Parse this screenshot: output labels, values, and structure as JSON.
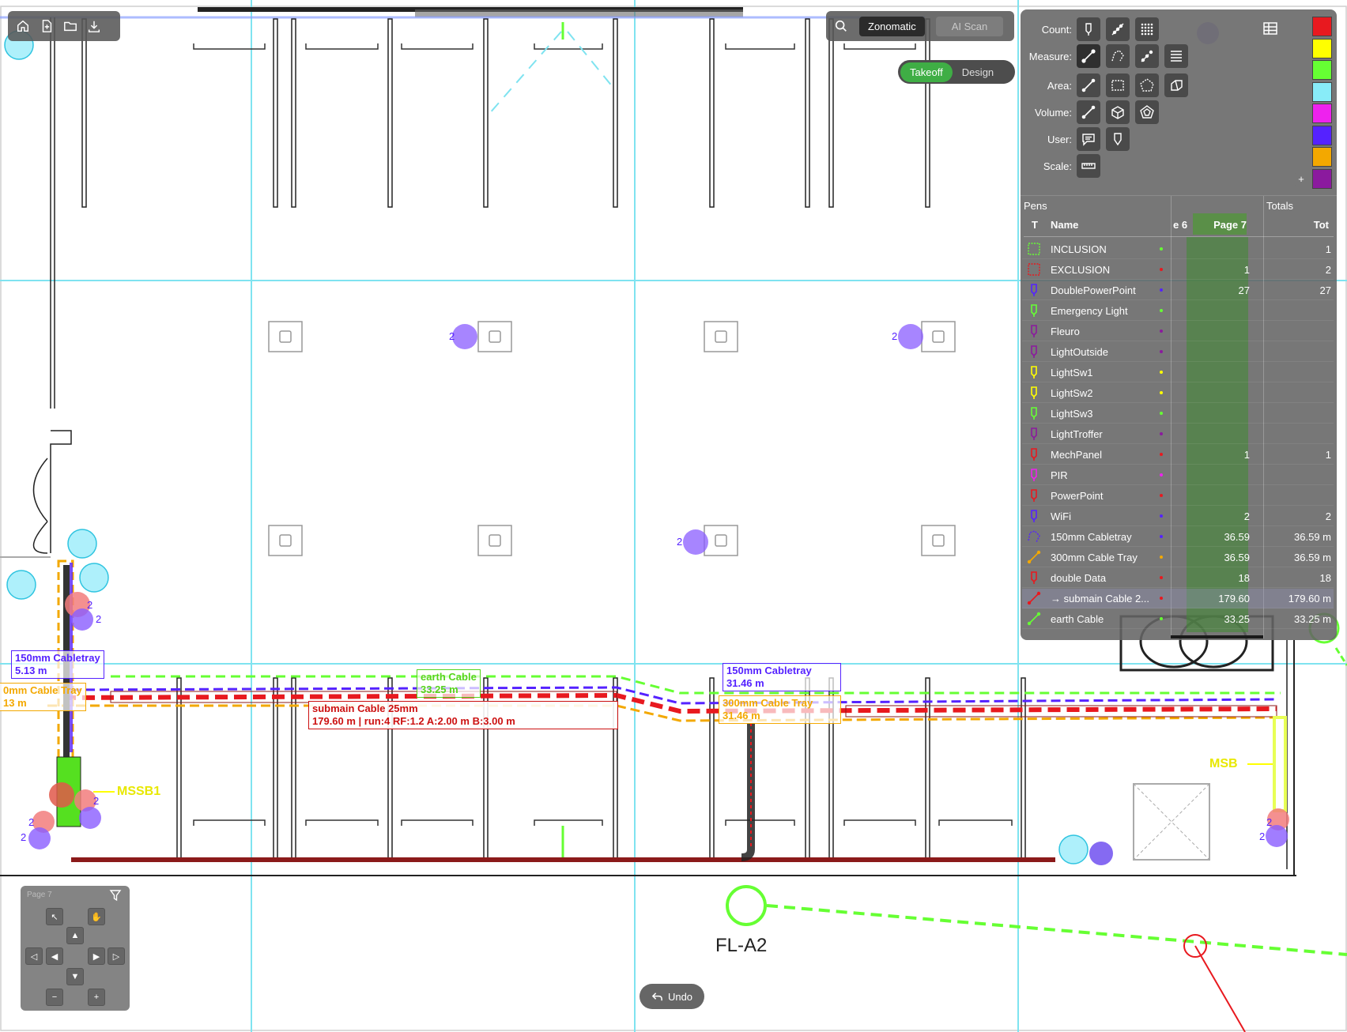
{
  "toolbar": {
    "zonomatic": "Zonomatic",
    "ai_scan": "AI Scan"
  },
  "mode": {
    "takeoff": "Takeoff",
    "design": "Design"
  },
  "tools": {
    "count": "Count:",
    "measure": "Measure:",
    "area": "Area:",
    "volume": "Volume:",
    "user": "User:",
    "scale": "Scale:"
  },
  "colors": [
    "#e8191f",
    "#ffff00",
    "#66ff33",
    "#88ecf8",
    "#ee22ee",
    "#5522ff",
    "#f3a800",
    "#8b1a9e"
  ],
  "pens": {
    "title": "Pens",
    "totals": "Totals",
    "col_t": "T",
    "col_name": "Name",
    "col_prev": "e 6",
    "col_page": "Page 7",
    "col_total": "Tot",
    "rows": [
      {
        "name": "INCLUSION",
        "page": "",
        "total": "1",
        "color": "#66ff33",
        "kind": "area"
      },
      {
        "name": "EXCLUSION",
        "page": "1",
        "total": "2",
        "color": "#e8191f",
        "kind": "area"
      },
      {
        "name": "DoublePowerPoint",
        "page": "27",
        "total": "27",
        "color": "#5522ff",
        "kind": "count"
      },
      {
        "name": "Emergency Light",
        "page": "",
        "total": "",
        "color": "#66ff33",
        "kind": "count"
      },
      {
        "name": "Fleuro",
        "page": "",
        "total": "",
        "color": "#8b1a9e",
        "kind": "count"
      },
      {
        "name": "LightOutside",
        "page": "",
        "total": "",
        "color": "#8b1a9e",
        "kind": "count"
      },
      {
        "name": "LightSw1",
        "page": "",
        "total": "",
        "color": "#ffff00",
        "kind": "count"
      },
      {
        "name": "LightSw2",
        "page": "",
        "total": "",
        "color": "#ffff00",
        "kind": "count"
      },
      {
        "name": "LightSw3",
        "page": "",
        "total": "",
        "color": "#66ff33",
        "kind": "count"
      },
      {
        "name": "LightTroffer",
        "page": "",
        "total": "",
        "color": "#8b1a9e",
        "kind": "count"
      },
      {
        "name": "MechPanel",
        "page": "1",
        "total": "1",
        "color": "#e8191f",
        "kind": "count"
      },
      {
        "name": "PIR",
        "page": "",
        "total": "",
        "color": "#ee22ee",
        "kind": "count"
      },
      {
        "name": "PowerPoint",
        "page": "",
        "total": "",
        "color": "#e8191f",
        "kind": "count"
      },
      {
        "name": "WiFi",
        "page": "2",
        "total": "2",
        "color": "#5522ff",
        "kind": "count"
      },
      {
        "name": "150mm Cabletray",
        "page": "36.59",
        "total": "36.59 m",
        "color": "#5522ff",
        "kind": "poly"
      },
      {
        "name": "300mm Cable Tray",
        "page": "36.59",
        "total": "36.59 m",
        "color": "#f3a800",
        "kind": "line"
      },
      {
        "name": "double Data",
        "page": "18",
        "total": "18",
        "color": "#e8191f",
        "kind": "count"
      },
      {
        "name": "→ submain Cable 2...",
        "page": "179.60",
        "total": "179.60 m",
        "color": "#e8191f",
        "kind": "line"
      },
      {
        "name": "earth Cable",
        "page": "33.25",
        "total": "33.25 m",
        "color": "#66ff33",
        "kind": "line"
      }
    ]
  },
  "nav": {
    "page_label": "Page 7"
  },
  "undo": "Undo",
  "drawing": {
    "labels": {
      "cabletray_left_name": "150mm Cabletray",
      "cabletray_left_len": "5.13 m",
      "tray300_left_name": "0mm Cable Tray",
      "tray300_left_len": "13 m",
      "earth_name": "earth Cable",
      "earth_len": "33.25 m",
      "submain_name": "submain Cable 25mm",
      "submain_detail": "179.60 m | run:4 RF:1.2 A:2.00 m B:3.00 m",
      "cabletray_mid_name": "150mm Cabletray",
      "cabletray_mid_len": "31.46 m",
      "tray300_mid_name": "300mm Cable Tray",
      "tray300_mid_len": "31.46 m",
      "mssb": "MSSB1",
      "msb": "MSB",
      "fl": "FL-A2",
      "badge": "2"
    }
  }
}
